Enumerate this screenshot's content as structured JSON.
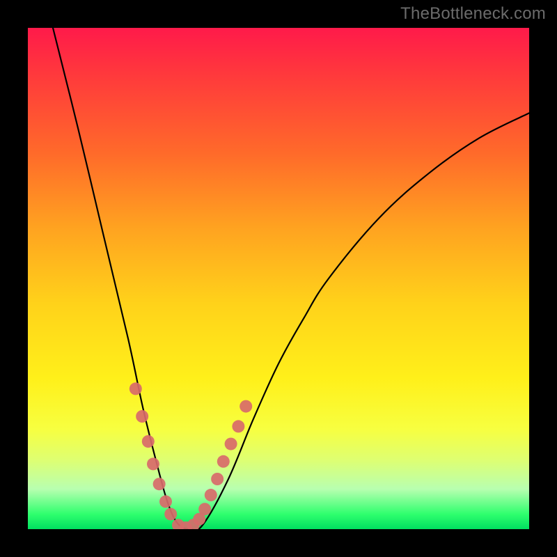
{
  "watermark": "TheBottleneck.com",
  "chart_data": {
    "type": "line",
    "title": "",
    "xlabel": "",
    "ylabel": "",
    "xlim": [
      0,
      100
    ],
    "ylim": [
      0,
      100
    ],
    "series": [
      {
        "name": "bottleneck-curve",
        "x": [
          5,
          10,
          15,
          20,
          23,
          26,
          28,
          30,
          32.5,
          35,
          40,
          45,
          50,
          55,
          60,
          70,
          80,
          90,
          100
        ],
        "values": [
          100,
          80,
          59,
          38,
          24,
          12,
          5,
          1,
          0,
          1,
          10,
          22,
          33,
          42,
          50,
          62,
          71,
          78,
          83
        ]
      }
    ],
    "markers": {
      "name": "highlight-points",
      "x": [
        21.5,
        22.8,
        24.0,
        25.0,
        26.2,
        27.5,
        28.5,
        30.0,
        31.5,
        33.0,
        34.2,
        35.3,
        36.5,
        37.8,
        39.0,
        40.5,
        42.0,
        43.5
      ],
      "values": [
        28.0,
        22.5,
        17.5,
        13.0,
        9.0,
        5.5,
        3.0,
        0.8,
        0.3,
        0.8,
        2.0,
        4.0,
        6.8,
        10.0,
        13.5,
        17.0,
        20.5,
        24.5
      ],
      "color": "#d86a6a",
      "radius_px": 9
    },
    "gradient_meaning": "red = high bottleneck, green = low bottleneck"
  }
}
